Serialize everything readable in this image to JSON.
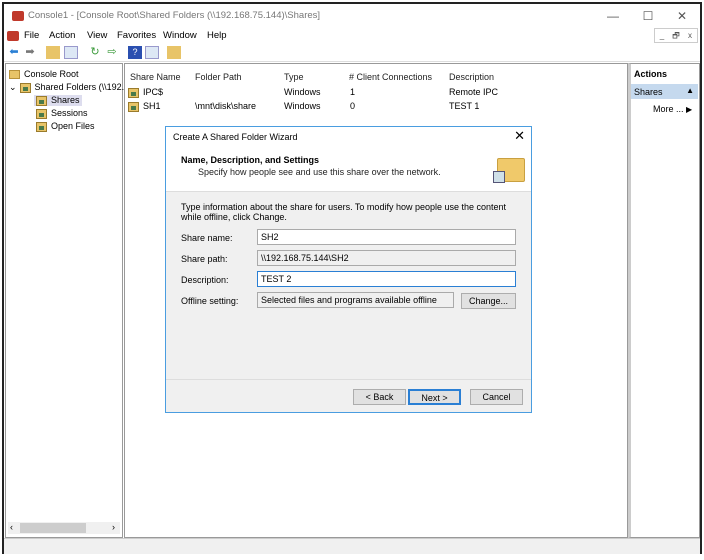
{
  "window": {
    "title": "Console1 - [Console Root\\Shared Folders (\\\\192.168.75.144)\\Shares]",
    "controls": [
      "—",
      "☐",
      "✕"
    ],
    "mdi_controls": [
      "_",
      "🗗",
      "x"
    ]
  },
  "menu": [
    "File",
    "Action",
    "View",
    "Favorites",
    "Window",
    "Help"
  ],
  "toolbar": {
    "icons": [
      "back-icon",
      "forward-icon",
      "up-folder-icon",
      "show-tree-icon",
      "refresh-icon",
      "export-icon",
      "help-icon",
      "action-pane-icon",
      "new-share-icon"
    ]
  },
  "tree": {
    "root": "Console Root",
    "shared": "Shared Folders (\\\\192.",
    "items": [
      "Shares",
      "Sessions",
      "Open Files"
    ]
  },
  "list": {
    "columns": [
      "Share Name",
      "Folder Path",
      "Type",
      "# Client Connections",
      "Description"
    ],
    "rows": [
      [
        "IPC$",
        "",
        "Windows",
        "1",
        "Remote IPC"
      ],
      [
        "SH1",
        "\\mnt\\disk\\share",
        "Windows",
        "0",
        "TEST 1"
      ]
    ]
  },
  "actions": {
    "header": "Actions",
    "section": "Shares",
    "more": "More ..."
  },
  "dialog": {
    "title": "Create A Shared Folder Wizard",
    "heading": "Name, Description, and Settings",
    "subheading": "Specify how people see and use this share over the network.",
    "intro": "Type information about the share for users. To modify how people use the content while offline, click Change.",
    "share_name_label": "Share name:",
    "share_name": "SH2",
    "share_path_label": "Share path:",
    "share_path": "\\\\192.168.75.144\\SH2",
    "description_label": "Description:",
    "description": "TEST 2",
    "offline_label": "Offline setting:",
    "offline": "Selected files and programs available offline",
    "change": "Change...",
    "back": "< Back",
    "next": "Next >",
    "cancel": "Cancel"
  }
}
